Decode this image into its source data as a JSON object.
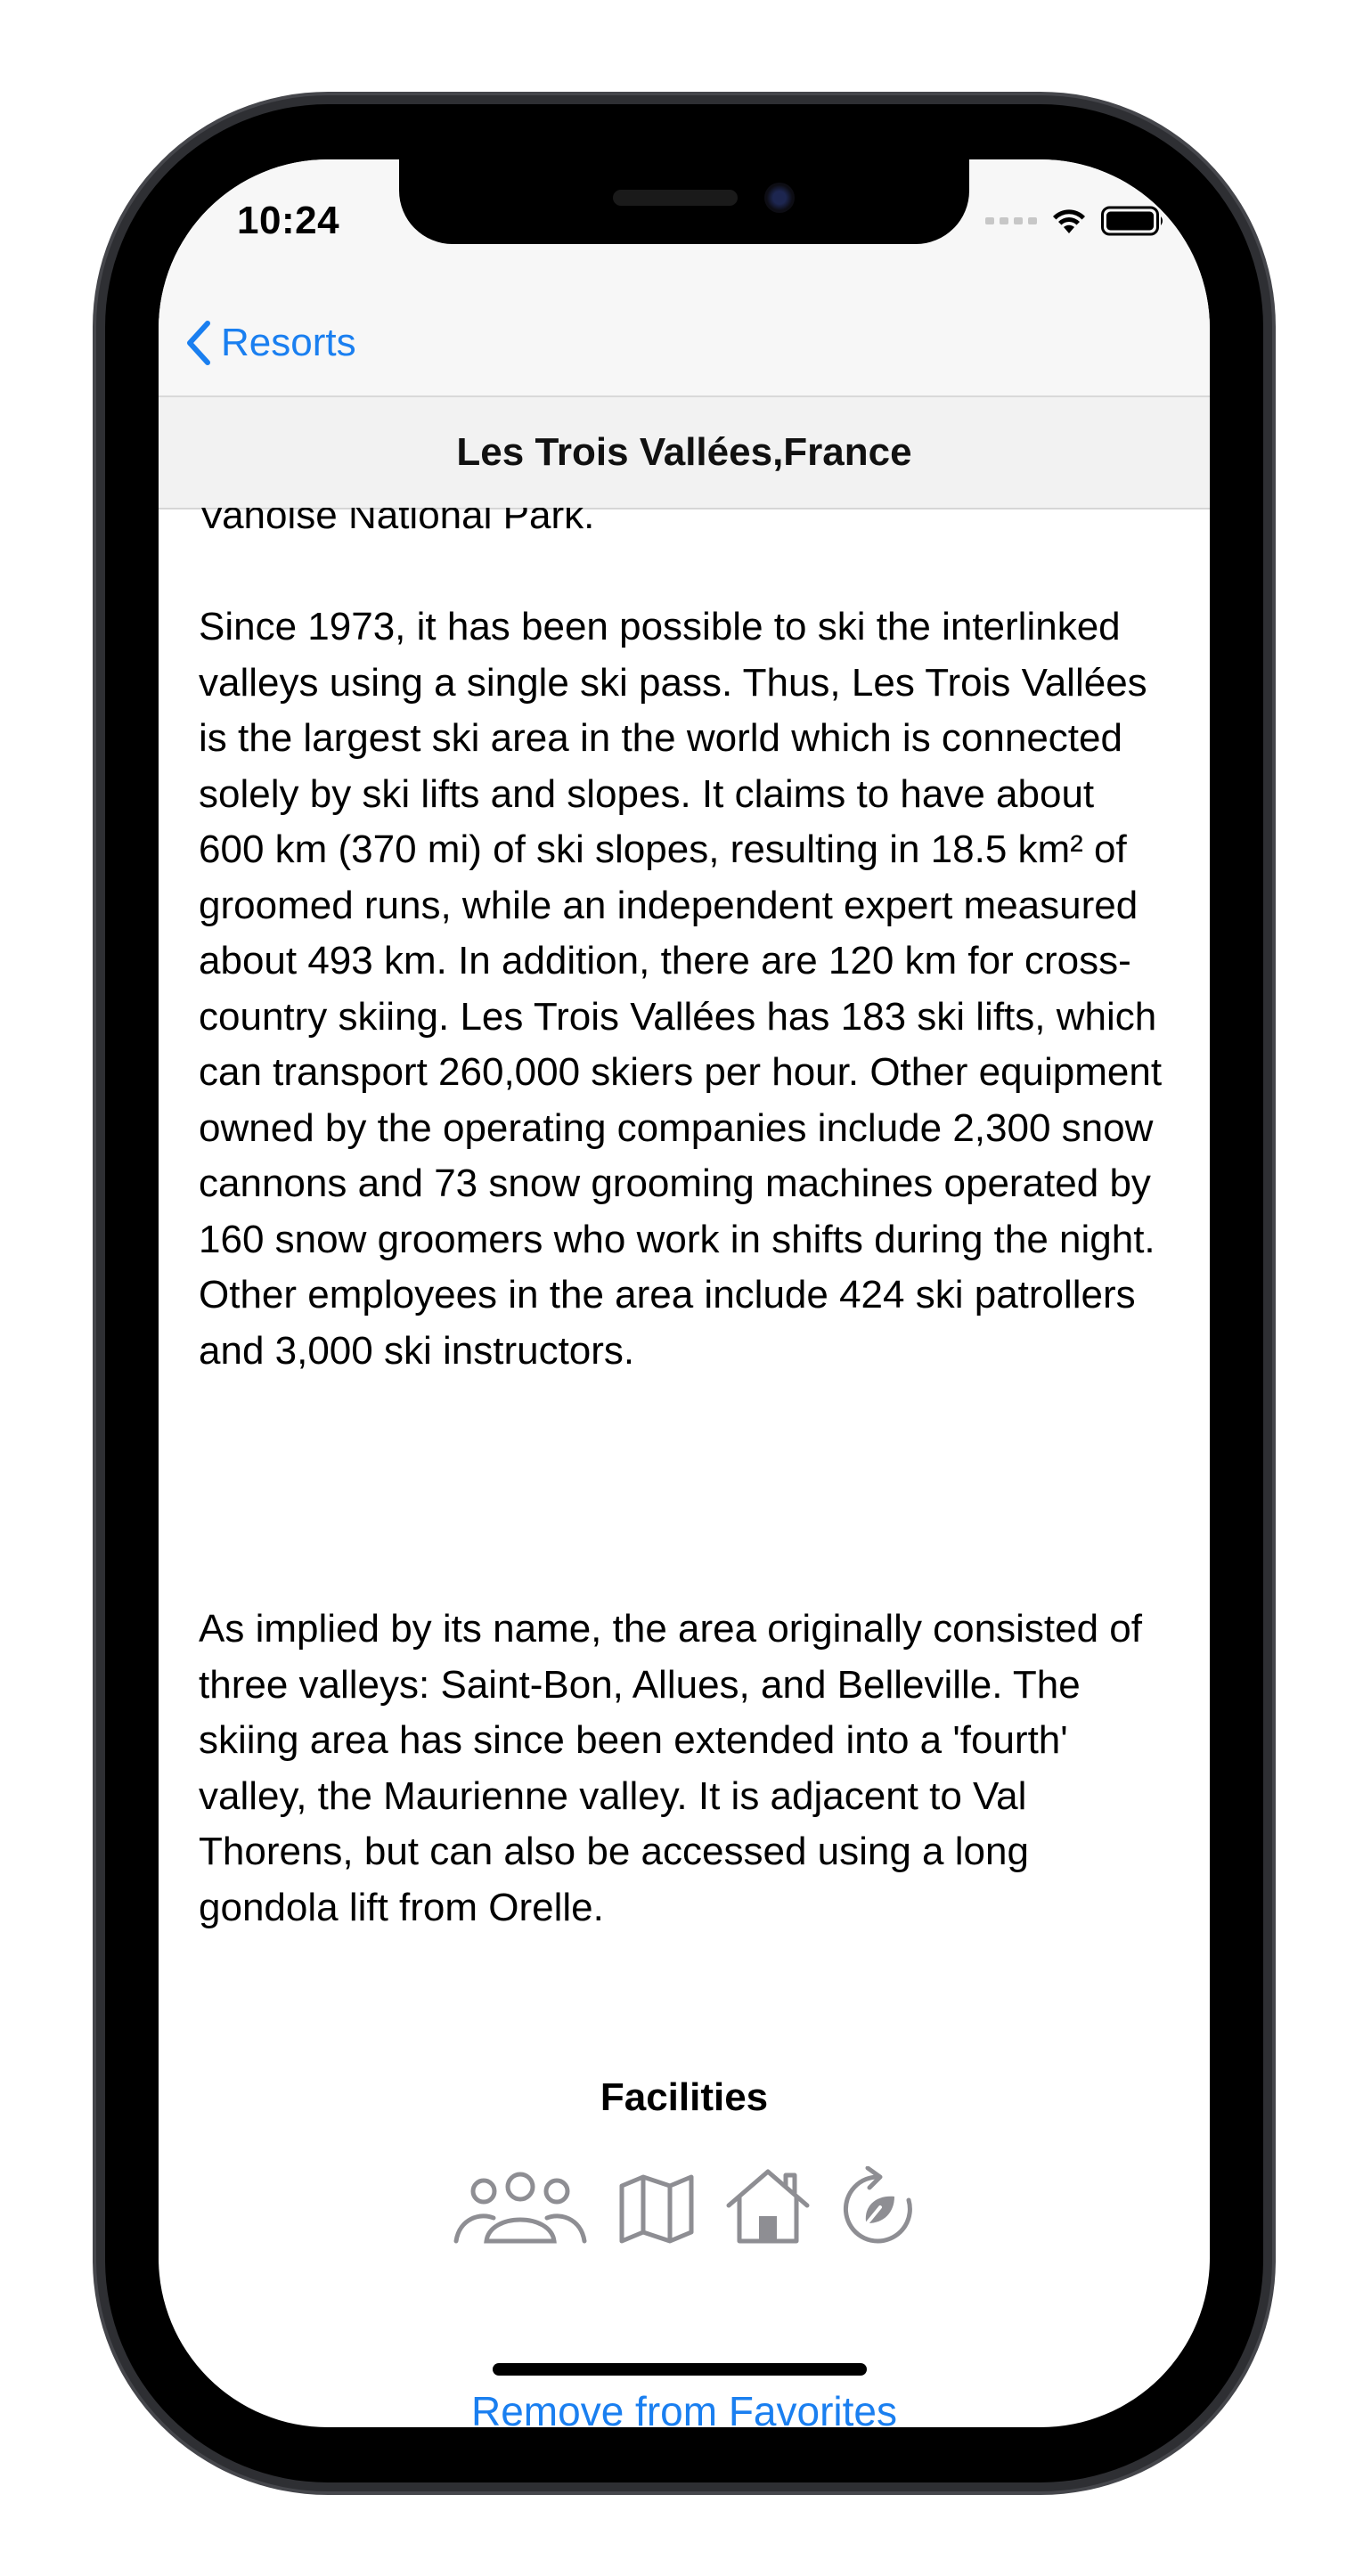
{
  "status_bar": {
    "time": "10:24"
  },
  "nav": {
    "back_label": "Resorts"
  },
  "header": {
    "title": "Les Trois Vallées,France"
  },
  "content": {
    "paragraphs": [
      "Vanoise National Park.",
      "Since 1973, it has been possible to ski the interlinked valleys using a single ski pass. Thus, Les Trois Vallées is the largest ski area in the world which is connected solely by ski lifts and slopes. It claims to have about 600 km (370 mi) of ski slopes, resulting in 18.5 km² of groomed runs, while an independent expert measured about 493 km. In addition, there are 120 km for cross-country skiing. Les Trois Vallées has 183 ski lifts, which can transport 260,000 skiers per hour. Other equipment owned by the operating companies include 2,300 snow cannons and 73 snow grooming machines operated by 160 snow groomers who work in shifts during the night. Other employees in the area include 424 ski patrollers and 3,000 ski instructors.",
      "As implied by its name, the area originally consisted of three valleys: Saint-Bon, Allues, and Belleville. The skiing area has since been extended into a 'fourth' valley, the Maurienne valley. It is adjacent to Val Thorens, but can also be accessed using a long gondola lift from Orelle."
    ]
  },
  "facilities": {
    "heading": "Facilities",
    "icons": [
      "people-icon",
      "map-icon",
      "house-icon",
      "eco-cycle-icon"
    ],
    "icon_color": "#8e8e93"
  },
  "actions": {
    "favorite_label": "Remove from Favorites"
  },
  "colors": {
    "accent": "#1a7ff0",
    "bar_background": "#f7f7f7"
  }
}
